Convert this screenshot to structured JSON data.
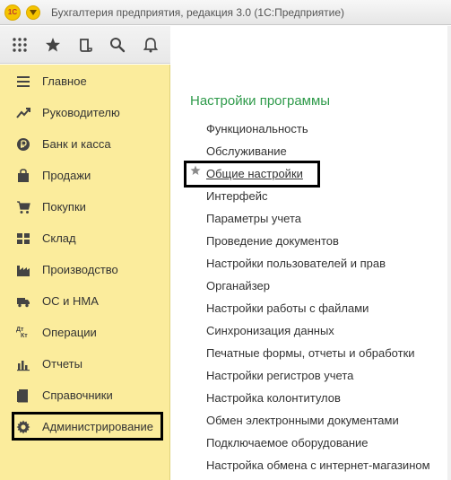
{
  "titlebar": {
    "logo_text": "1С",
    "title": "Бухгалтерия предприятия, редакция 3.0  (1С:Предприятие)"
  },
  "toolbar": {
    "icons": [
      "apps-grid-icon",
      "star-icon",
      "history-icon",
      "search-icon",
      "bell-icon"
    ]
  },
  "sidebar": {
    "items": [
      {
        "label": "Главное",
        "icon": "menu-lines-icon"
      },
      {
        "label": "Руководителю",
        "icon": "trend-icon"
      },
      {
        "label": "Банк и касса",
        "icon": "ruble-coin-icon"
      },
      {
        "label": "Продажи",
        "icon": "shopping-bag-icon"
      },
      {
        "label": "Покупки",
        "icon": "cart-icon"
      },
      {
        "label": "Склад",
        "icon": "warehouse-grid-icon"
      },
      {
        "label": "Производство",
        "icon": "factory-icon"
      },
      {
        "label": "ОС и НМА",
        "icon": "truck-icon"
      },
      {
        "label": "Операции",
        "icon": "dt-kt-icon"
      },
      {
        "label": "Отчеты",
        "icon": "bar-chart-icon"
      },
      {
        "label": "Справочники",
        "icon": "books-icon"
      },
      {
        "label": "Администрирование",
        "icon": "gear-icon"
      }
    ],
    "dt_label": "Дт",
    "kt_label": "Кт"
  },
  "main": {
    "section_title": "Настройки программы",
    "links": [
      "Функциональность",
      "Обслуживание",
      "Общие настройки",
      "Интерфейс",
      "Параметры учета",
      "Проведение документов",
      "Настройки пользователей и прав",
      "Органайзер",
      "Настройки работы с файлами",
      "Синхронизация данных",
      "Печатные формы, отчеты и обработки",
      "Настройки регистров учета",
      "Настройка колонтитулов",
      "Обмен электронными документами",
      "Подключаемое оборудование",
      "Настройка обмена с интернет-магазином"
    ]
  },
  "colors": {
    "sidebar_bg": "#fbec9c",
    "section_title": "#2e9a4a",
    "highlight_border": "#000000",
    "logo_bg": "#f5c400"
  }
}
